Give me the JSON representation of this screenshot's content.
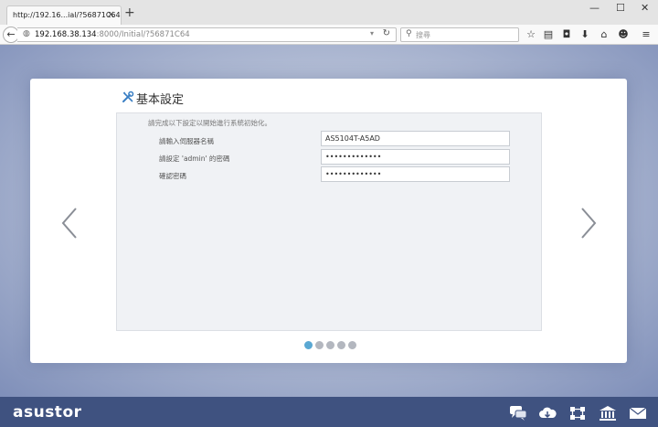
{
  "browser": {
    "tab_title": "http://192.16...ial/?56871C64",
    "tab_close": "×",
    "new_tab": "+",
    "win_minimize": "—",
    "win_maximize": "☐",
    "win_close": "✕",
    "url_host": "192.168.38.134",
    "url_path": ":8000/Initial/?56871C64",
    "search_placeholder": "搜尋"
  },
  "wizard": {
    "title": "基本設定",
    "intro": "請完成以下設定以開始進行系統初始化。",
    "fields": [
      {
        "label": "請輸入伺服器名稱",
        "value": "AS5104T-A5AD",
        "type": "text"
      },
      {
        "label": "請設定 'admin' 的密碼",
        "value": "•••••••••••••",
        "type": "password"
      },
      {
        "label": "確認密碼",
        "value": "•••••••••••••",
        "type": "password"
      }
    ],
    "steps": {
      "total": 5,
      "current": 1
    }
  },
  "footer": {
    "logo": "asustor",
    "icons": [
      "chat-icon",
      "cloud-download-icon",
      "network-icon",
      "bank-icon",
      "mail-icon"
    ]
  },
  "colors": {
    "footer_bg": "#3f5280",
    "active_dot": "#5aa8d3",
    "inactive_dot": "#b3b7bf"
  }
}
